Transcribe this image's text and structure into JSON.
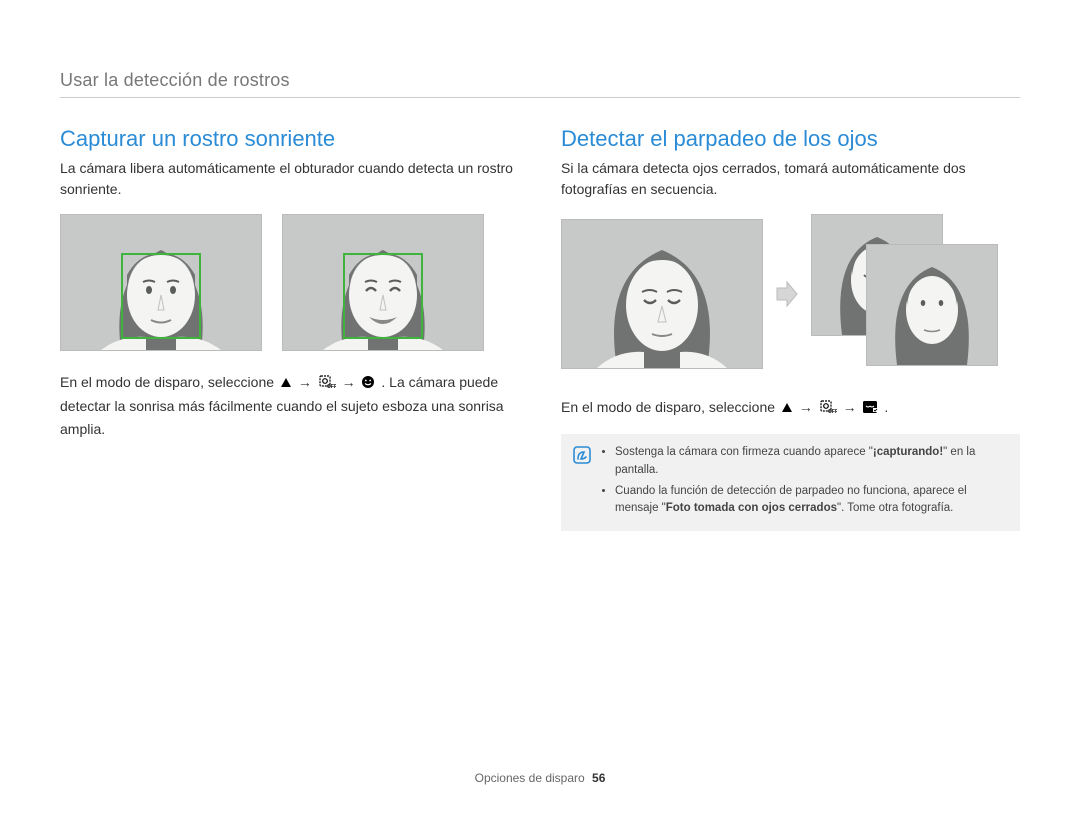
{
  "breadcrumb": "Usar la detección de rostros",
  "left": {
    "heading": "Capturar un rostro sonriente",
    "lead": "La cámara libera automáticamente el obturador cuando detecta un rostro sonriente.",
    "instruction_pre": "En el modo de disparo, seleccione ",
    "instruction_post": ". La cámara puede detectar la sonrisa más fácilmente cuando el sujeto esboza una sonrisa amplia.",
    "arrow": "→"
  },
  "right": {
    "heading": "Detectar el parpadeo de los ojos",
    "lead": "Si la cámara detecta ojos cerrados, tomará automáticamente dos fotografías en secuencia.",
    "instruction_pre": "En el modo de disparo, seleccione ",
    "instruction_post": ".",
    "arrow": "→",
    "note1_pre": "Sostenga la cámara con firmeza cuando aparece \"",
    "note1_bold": "¡capturando!",
    "note1_post": "\" en la pantalla.",
    "note2_pre": "Cuando la función de detección de parpadeo no funciona, aparece el mensaje \"",
    "note2_bold": "Foto tomada con ojos cerrados",
    "note2_post": "\". Tome otra fotografía."
  },
  "footer_label": "Opciones de disparo",
  "page_number": "56"
}
